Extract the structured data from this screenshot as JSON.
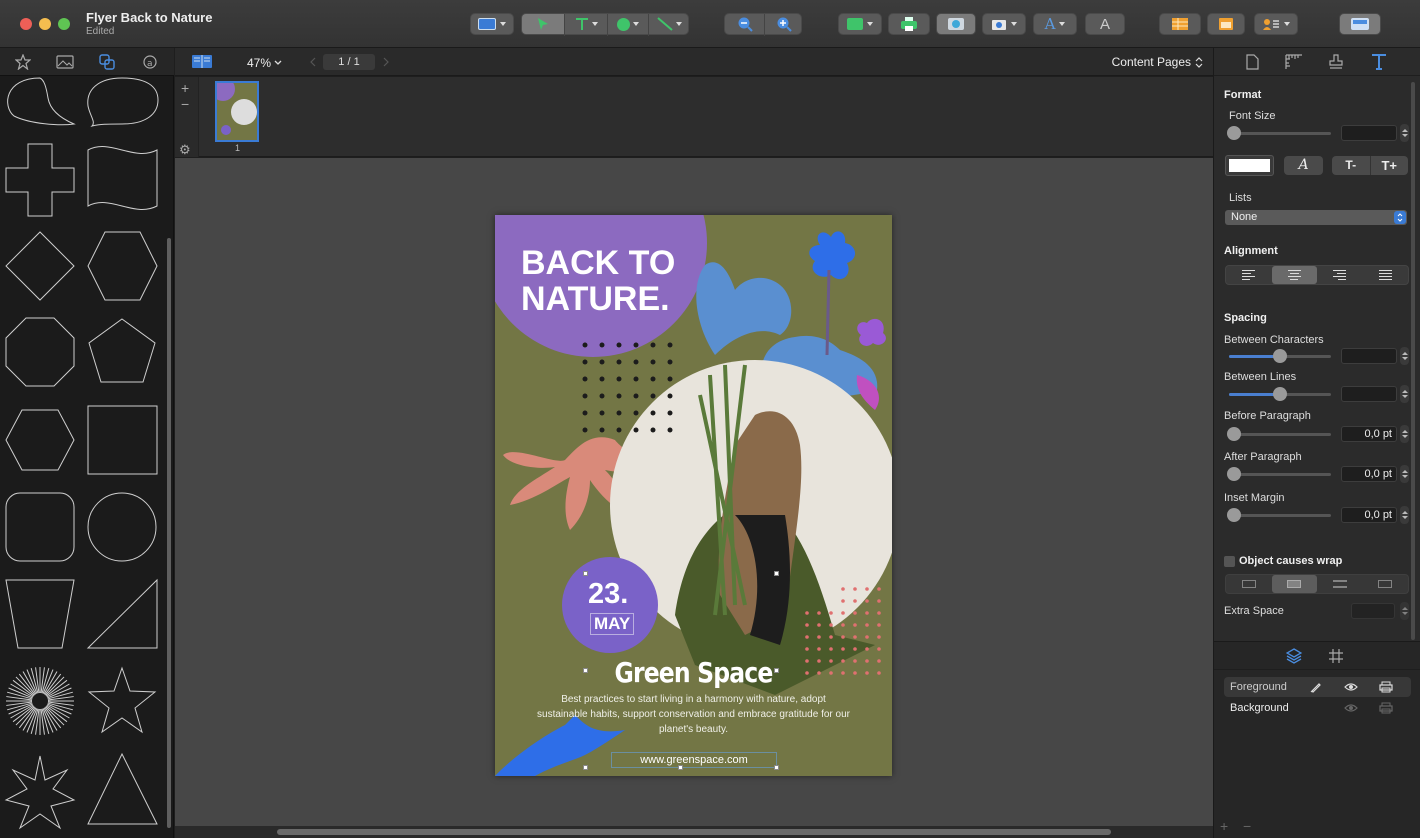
{
  "window": {
    "title": "Flyer Back to Nature",
    "subtitle": "Edited"
  },
  "docbar": {
    "zoom": "47%",
    "page_indicator": "1 / 1",
    "view_mode": "Content Pages"
  },
  "thumbs": {
    "page_number": "1"
  },
  "flyer": {
    "headline_1": "BACK TO",
    "headline_2": "NATURE.",
    "date_day": "23.",
    "date_month": "MAY",
    "title": "Green Space",
    "body": "Best practices to start living in a harmony with nature, adopt sustainable habits, support conservation and embrace gratitude for our planet's beauty.",
    "url": "www.greenspace.com",
    "colors": {
      "background": "#737645",
      "purple": "#8c6ac0",
      "blue": "#5a8fd0",
      "coral": "#d98a7a",
      "dots_pink": "#e07070"
    }
  },
  "inspector": {
    "format_header": "Format",
    "font_size_label": "Font Size",
    "lists_label": "Lists",
    "lists_value": "None",
    "alignment_header": "Alignment",
    "spacing_header": "Spacing",
    "between_characters": "Between Characters",
    "between_lines": "Between Lines",
    "before_paragraph": "Before Paragraph",
    "before_paragraph_value": "0,0 pt",
    "after_paragraph": "After Paragraph",
    "after_paragraph_value": "0,0 pt",
    "inset_margin": "Inset Margin",
    "inset_margin_value": "0,0 pt",
    "wrap_label": "Object causes wrap",
    "extra_space": "Extra Space",
    "font_style_glyph": "A",
    "size_down_glyph": "T-",
    "size_up_glyph": "T+"
  },
  "layers": {
    "items": [
      {
        "name": "Foreground"
      },
      {
        "name": "Background"
      }
    ]
  },
  "bottom": {
    "add": "+",
    "remove": "−"
  }
}
